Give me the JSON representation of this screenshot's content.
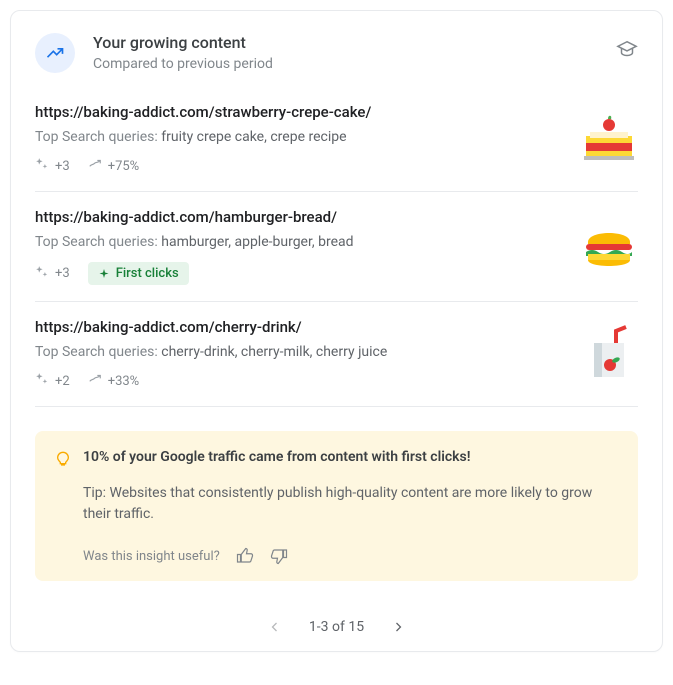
{
  "header": {
    "title": "Your growing content",
    "subtitle": "Compared to previous period"
  },
  "queries_label": "Top Search queries:",
  "rows": [
    {
      "url": "https://baking-addict.com/strawberry-crepe-cake/",
      "queries": "fruity crepe cake, crepe recipe",
      "clicks_delta": "+3",
      "growth": "+75%",
      "first_clicks": false
    },
    {
      "url": "https://baking-addict.com/hamburger-bread/",
      "queries": "hamburger, apple-burger, bread",
      "clicks_delta": "+3",
      "growth": null,
      "first_clicks": true,
      "first_clicks_label": "First clicks"
    },
    {
      "url": "https://baking-addict.com/cherry-drink/",
      "queries": "cherry-drink, cherry-milk, cherry juice",
      "clicks_delta": "+2",
      "growth": "+33%",
      "first_clicks": false
    }
  ],
  "insight": {
    "title": "10% of your Google traffic came from content with first clicks!",
    "tip": "Tip: Websites that consistently publish high-quality content are more likely to grow their traffic.",
    "feedback_prompt": "Was this insight useful?"
  },
  "pager": {
    "range": "1-3 of 15"
  }
}
